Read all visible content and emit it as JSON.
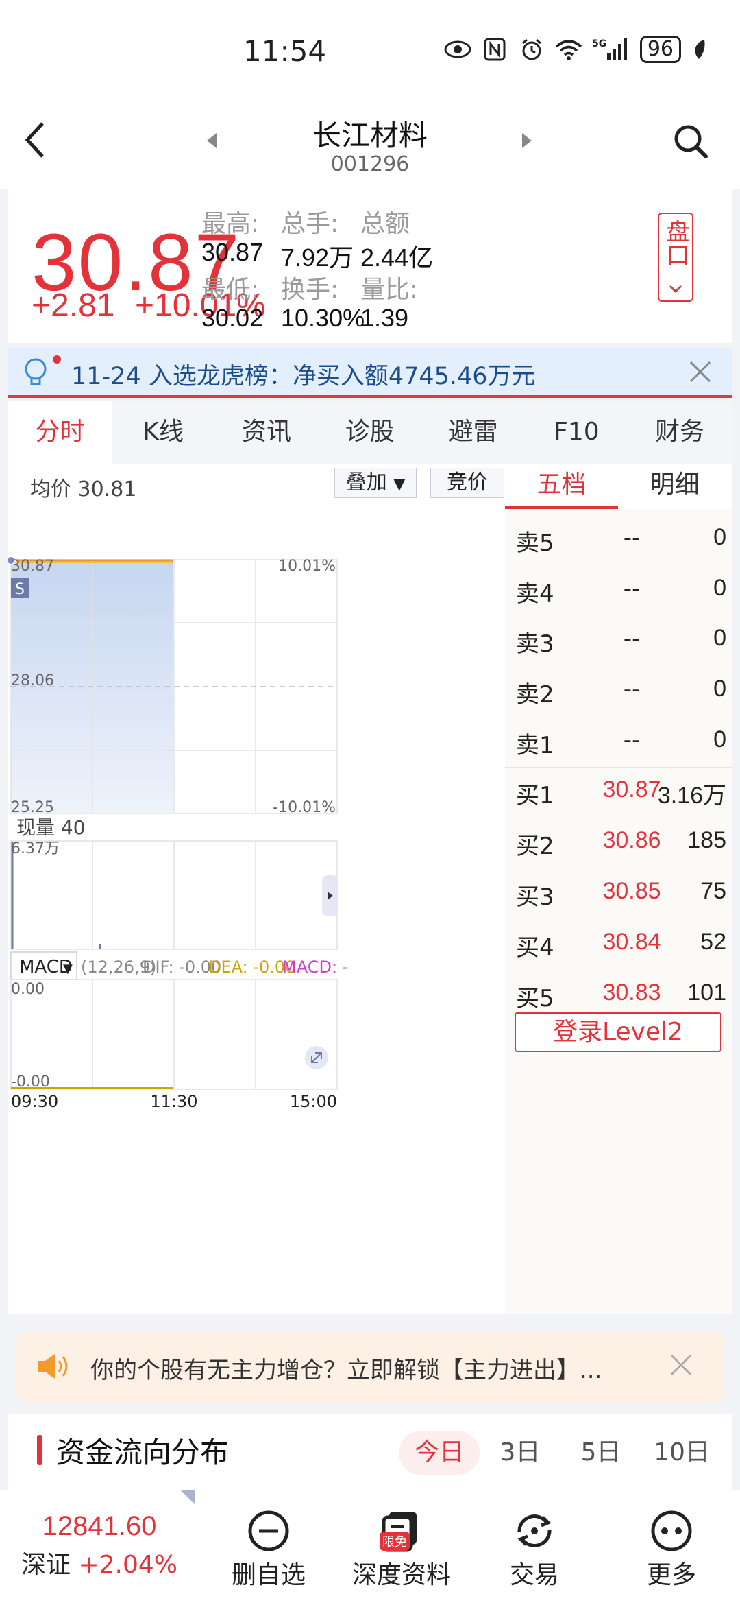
{
  "status": {
    "time": "11:54",
    "battery": "96",
    "network": "5G"
  },
  "nav": {
    "title": "长江材料",
    "code": "001296"
  },
  "quote": {
    "price": "30.87",
    "change": "+2.81",
    "change_pct": "+10.01%",
    "stats": [
      {
        "label": "最高:",
        "value": "30.87"
      },
      {
        "label": "总手:",
        "value": "7.92万"
      },
      {
        "label": "总额",
        "value": "2.44亿"
      },
      {
        "label": "最低:",
        "value": "30.02"
      },
      {
        "label": "换手:",
        "value": "10.30%"
      },
      {
        "label": "量比:",
        "value": "1.39"
      }
    ],
    "pankou": "盘口"
  },
  "banner": {
    "text": "11-24 入选龙虎榜：净买入额4745.46万元"
  },
  "tabs": [
    "分时",
    "K线",
    "资讯",
    "诊股",
    "避雷",
    "F10",
    "财务"
  ],
  "chart": {
    "avg_label": "均价 30.81",
    "overlay_btn": "叠加",
    "bid_btn": "竞价",
    "marker": "S",
    "price_high": "30.87",
    "price_mid": "28.06",
    "price_low": "25.25",
    "pct_high": "10.01%",
    "pct_low": "-10.01%",
    "vol_label": "现量 40",
    "vol_max": "6.37万",
    "macd_select": "MACD",
    "macd_params": "(12,26,9)",
    "macd_dif": "DIF: -0.00",
    "macd_dea": "DEA: -0.00",
    "macd_val": "MACD: -",
    "macd_top": "0.00",
    "macd_bottom": "-0.00",
    "time_start": "09:30",
    "time_mid": "11:30",
    "time_end": "15:00",
    "colors": {
      "price_line": "#e8923a",
      "avg_line": "#f0c040",
      "fill": "#c6d6f0",
      "dea": "#c8a800",
      "macd": "#d23ad2"
    }
  },
  "orderbook": {
    "tabs": [
      "五档",
      "明细"
    ],
    "sells": [
      {
        "label": "卖5",
        "price": "--",
        "vol": "0"
      },
      {
        "label": "卖4",
        "price": "--",
        "vol": "0"
      },
      {
        "label": "卖3",
        "price": "--",
        "vol": "0"
      },
      {
        "label": "卖2",
        "price": "--",
        "vol": "0"
      },
      {
        "label": "卖1",
        "price": "--",
        "vol": "0"
      }
    ],
    "buys": [
      {
        "label": "买1",
        "price": "30.87",
        "vol": "3.16万"
      },
      {
        "label": "买2",
        "price": "30.86",
        "vol": "185"
      },
      {
        "label": "买3",
        "price": "30.85",
        "vol": "75"
      },
      {
        "label": "买4",
        "price": "30.84",
        "vol": "52"
      },
      {
        "label": "买5",
        "price": "30.83",
        "vol": "101"
      }
    ],
    "level2": "登录Level2"
  },
  "ad": {
    "text": "你的个股有无主力增仓？立即解锁【主力进出】..."
  },
  "fund": {
    "title": "资金流向分布",
    "periods": [
      "今日",
      "3日",
      "5日",
      "10日"
    ]
  },
  "bottom": {
    "index_value": "12841.60",
    "index_name": "深证",
    "index_change": "+2.04%",
    "items": [
      "删自选",
      "深度资料",
      "交易",
      "更多"
    ],
    "badge": "限免"
  }
}
